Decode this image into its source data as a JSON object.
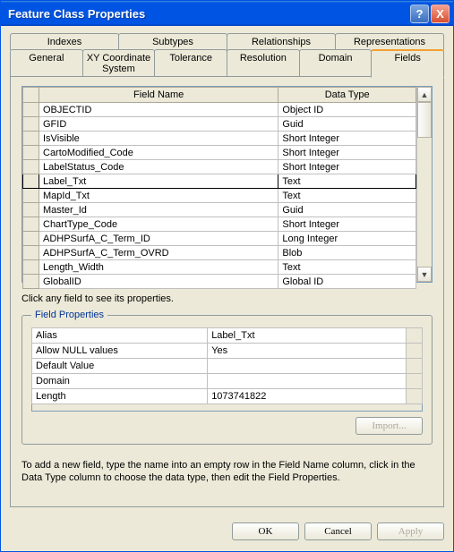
{
  "window": {
    "title": "Feature Class Properties",
    "help": "?",
    "close": "X"
  },
  "tabs": {
    "row1": [
      "Indexes",
      "Subtypes",
      "Relationships",
      "Representations"
    ],
    "row2": [
      "General",
      "XY Coordinate System",
      "Tolerance",
      "Resolution",
      "Domain",
      "Fields"
    ],
    "active": "Fields"
  },
  "fields_table": {
    "headers": {
      "name": "Field Name",
      "type": "Data Type"
    },
    "rows": [
      {
        "name": "OBJECTID",
        "type": "Object ID"
      },
      {
        "name": "GFID",
        "type": "Guid"
      },
      {
        "name": "IsVisible",
        "type": "Short Integer"
      },
      {
        "name": "CartoModified_Code",
        "type": "Short Integer"
      },
      {
        "name": "LabelStatus_Code",
        "type": "Short Integer"
      },
      {
        "name": "Label_Txt",
        "type": "Text",
        "selected": true
      },
      {
        "name": "MapId_Txt",
        "type": "Text"
      },
      {
        "name": "Master_Id",
        "type": "Guid"
      },
      {
        "name": "ChartType_Code",
        "type": "Short Integer"
      },
      {
        "name": "ADHPSurfA_C_Term_ID",
        "type": "Long Integer"
      },
      {
        "name": "ADHPSurfA_C_Term_OVRD",
        "type": "Blob"
      },
      {
        "name": "Length_Width",
        "type": "Text"
      },
      {
        "name": "GlobalID",
        "type": "Global ID"
      }
    ]
  },
  "hint": "Click any field to see its properties.",
  "fieldset_title": "Field Properties",
  "props": [
    {
      "name": "Alias",
      "value": "Label_Txt"
    },
    {
      "name": "Allow NULL values",
      "value": "Yes"
    },
    {
      "name": "Default Value",
      "value": ""
    },
    {
      "name": "Domain",
      "value": ""
    },
    {
      "name": "Length",
      "value": "1073741822"
    }
  ],
  "import_label": "Import...",
  "help_text": "To add a new field, type the name into an empty row in the Field Name column, click in the Data Type column to choose the data type, then edit the Field Properties.",
  "buttons": {
    "ok": "OK",
    "cancel": "Cancel",
    "apply": "Apply"
  },
  "scroll": {
    "up": "▲",
    "down": "▼"
  }
}
